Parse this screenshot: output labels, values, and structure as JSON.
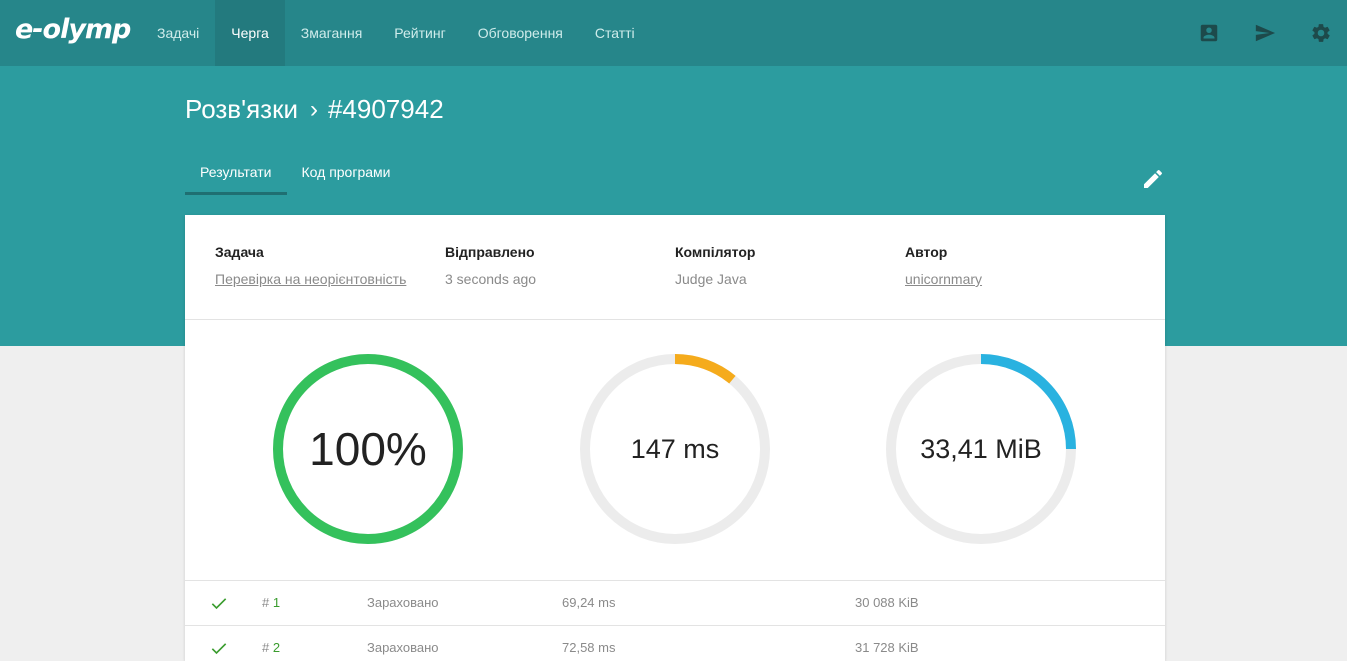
{
  "app": {
    "logo": "e-olymp"
  },
  "nav": {
    "items": [
      {
        "label": "Задачі"
      },
      {
        "label": "Черга"
      },
      {
        "label": "Змагання"
      },
      {
        "label": "Рейтинг"
      },
      {
        "label": "Обговорення"
      },
      {
        "label": "Статті"
      }
    ],
    "active_index": 1
  },
  "icons": {
    "account": "account-box-icon",
    "send": "send-icon",
    "settings": "gear-icon",
    "edit": "pencil-icon",
    "check": "check-icon"
  },
  "breadcrumb": {
    "parent": "Розв'язки",
    "separator": "›",
    "current": "#4907942"
  },
  "tabs": [
    {
      "label": "Результати",
      "active": true
    },
    {
      "label": "Код програми",
      "active": false
    }
  ],
  "info": {
    "task": {
      "label": "Задача",
      "value": "Перевірка на неорієнтовність"
    },
    "sent": {
      "label": "Відправлено",
      "value": "3 seconds ago"
    },
    "compiler": {
      "label": "Компілятор",
      "value": "Judge Java"
    },
    "author": {
      "label": "Автор",
      "value": "unicornmary"
    }
  },
  "gauges": [
    {
      "text": "100%",
      "fraction": 1.0,
      "color": "#34c15c"
    },
    {
      "text": "147 ms",
      "fraction": 0.11,
      "color": "#f5ab1c"
    },
    {
      "text": "33,41 MiB",
      "fraction": 0.25,
      "color": "#29b2e0"
    }
  ],
  "colors": {
    "topbar": "#26868a",
    "hero": "#2c9c9f",
    "track": "#ececec",
    "accepted": "#3a9c2e"
  },
  "tests": [
    {
      "hash": "#",
      "num": "1",
      "status": "Зараховано",
      "time": "69,24 ms",
      "memory": "30 088 KiB"
    },
    {
      "hash": "#",
      "num": "2",
      "status": "Зараховано",
      "time": "72,58 ms",
      "memory": "31 728 KiB"
    }
  ]
}
